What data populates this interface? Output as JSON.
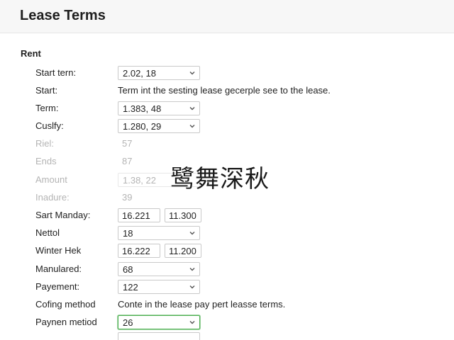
{
  "header": {
    "title": "Lease Terms"
  },
  "section": {
    "title": "Rent"
  },
  "rows": {
    "start_term": {
      "label": "Start tern:",
      "value": "2.02, 18"
    },
    "start": {
      "label": "Start:",
      "text": "Term int the sesting lease gecerple see to the lease."
    },
    "term": {
      "label": "Term:",
      "value": "1.383, 48"
    },
    "cuslfy": {
      "label": "Cuslfy:",
      "value": "1.280, 29"
    },
    "riel": {
      "label": "Riel:",
      "value": "57"
    },
    "ends": {
      "label": "Ends",
      "value": "87"
    },
    "amount": {
      "label": "Amount",
      "value": "1.38, 22"
    },
    "inadure": {
      "label": "Inadure:",
      "value": "39"
    },
    "sart_manday": {
      "label": "Sart Manday:",
      "value_a": "16.221",
      "value_b": "11.300"
    },
    "nettol": {
      "label": "Nettol",
      "value": "18"
    },
    "winter_hek": {
      "label": "Winter Hek",
      "value_a": "16.222",
      "value_b": "11.200"
    },
    "manulared": {
      "label": "Manulared:",
      "value": "68"
    },
    "payement": {
      "label": "Payement:",
      "value": "122"
    },
    "cofing_method": {
      "label": "Cofing method",
      "text": "Conte in the lease pay pert leasse terms."
    },
    "paynen_method": {
      "label": "Paynen metiod",
      "value": "26"
    }
  },
  "overlay": {
    "watermark": "鹭舞深秋"
  },
  "icons": {
    "dropdown": "chevron-down-icon"
  },
  "colors": {
    "focus": "#4caf50",
    "disabled_text": "#b4b4b4",
    "border": "#c9c9c9"
  }
}
